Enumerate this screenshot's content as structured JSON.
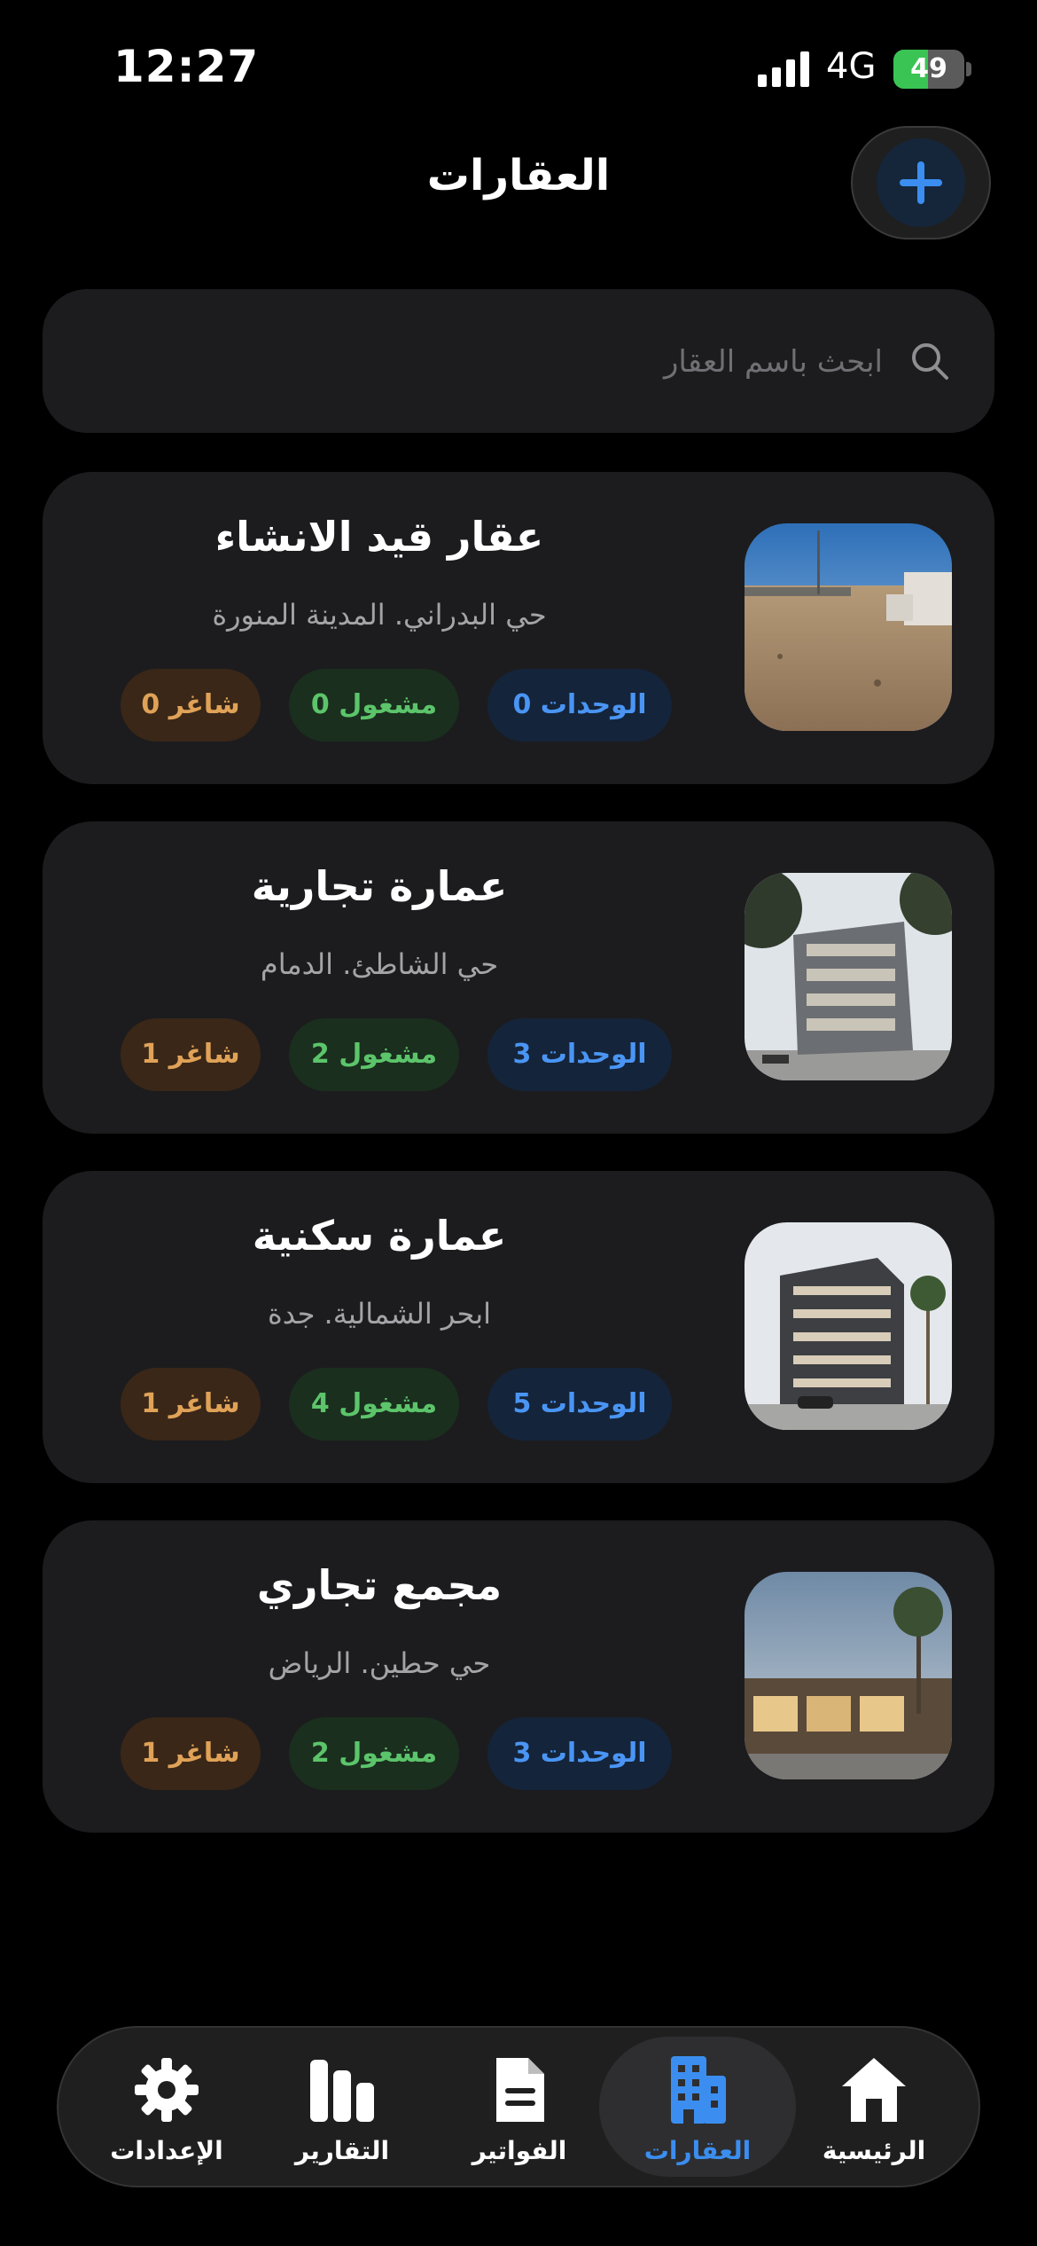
{
  "status": {
    "time": "12:27",
    "network": "4G",
    "battery": "49",
    "battery_level_percent": 49
  },
  "header": {
    "title": "العقارات"
  },
  "search": {
    "placeholder": "ابحث باسم العقار"
  },
  "properties": [
    {
      "title": "عقار قيد الانشاء",
      "location": "حي البدراني. المدينة المنورة",
      "units": "الوحدات 0",
      "occupied": "مشغول 0",
      "vacant": "شاغر 0"
    },
    {
      "title": "عمارة تجارية",
      "location": "حي الشاطئ. الدمام",
      "units": "الوحدات 3",
      "occupied": "مشغول 2",
      "vacant": "شاغر 1"
    },
    {
      "title": "عمارة سكنية",
      "location": "ابحر الشمالية. جدة",
      "units": "الوحدات 5",
      "occupied": "مشغول 4",
      "vacant": "شاغر 1"
    },
    {
      "title": "مجمع تجاري",
      "location": "حي حطين. الرياض",
      "units": "الوحدات 3",
      "occupied": "مشغول 2",
      "vacant": "شاغر 1"
    }
  ],
  "tabs": [
    {
      "label": "الرئيسية",
      "icon": "home-icon"
    },
    {
      "label": "العقارات",
      "icon": "building-icon",
      "active": true
    },
    {
      "label": "الفواتير",
      "icon": "document-icon"
    },
    {
      "label": "التقارير",
      "icon": "chart-bars-icon"
    },
    {
      "label": "الإعدادات",
      "icon": "gear-icon"
    }
  ],
  "colors": {
    "accent": "#3b8ef0",
    "units": "#4a95f4",
    "occupied": "#5cc46a",
    "vacant": "#e0a257",
    "card": "#1c1c1e"
  }
}
